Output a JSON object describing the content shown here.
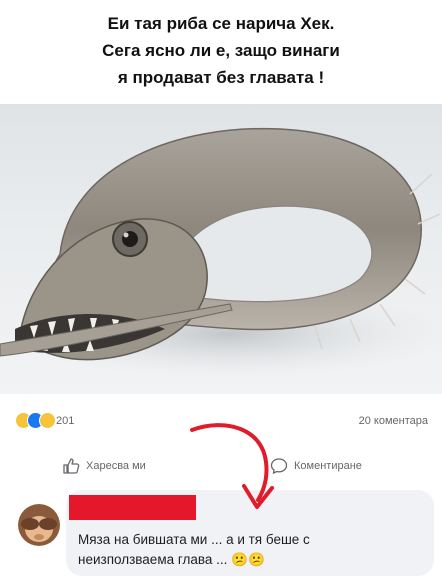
{
  "caption": {
    "line1": "Еи тая риба се нарича Хек.",
    "line2": "Сега ясно ли е, защо винаги",
    "line3": "я продават без главата !"
  },
  "reactions": {
    "icons": [
      "haha-emoji",
      "like-thumb",
      "wow-emoji"
    ],
    "count": "201"
  },
  "comments_count": "20 коментара",
  "actions": {
    "like": "Харесва ми",
    "comment": "Коментиране"
  },
  "comment": {
    "line1": "Мяза на бившата ми ... а и тя беше с",
    "line2": "неизползваема глава ... 😕😕"
  },
  "colors": {
    "redaction": "#e5172a",
    "arrow": "#e21b2b",
    "meta_text": "#65676b",
    "bubble": "#f0f2f5"
  }
}
